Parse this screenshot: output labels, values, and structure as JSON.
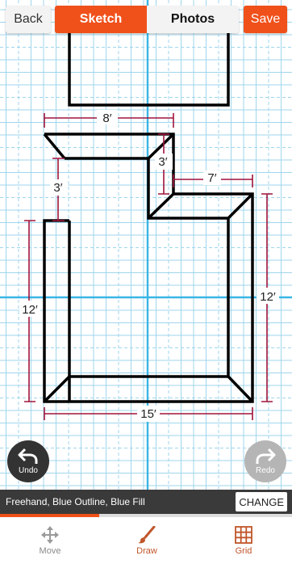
{
  "header": {
    "back_label": "Back",
    "tabs": [
      {
        "label": "Sketch",
        "active": true
      },
      {
        "label": "Photos",
        "active": false
      }
    ],
    "save_label": "Save"
  },
  "sketch": {
    "dimensions": [
      "8′",
      "3′",
      "3′",
      "7′",
      "12′",
      "12′",
      "15′"
    ]
  },
  "controls": {
    "undo_label": "Undo",
    "redo_label": "Redo"
  },
  "status": {
    "mode_text": "Freehand, Blue Outline, Blue Fill",
    "change_label": "CHANGE",
    "progress": 0.34
  },
  "toolbar": {
    "items": [
      {
        "label": "Move",
        "icon": "move-icon",
        "active": false
      },
      {
        "label": "Draw",
        "icon": "brush-icon",
        "active": true
      },
      {
        "label": "Grid",
        "icon": "grid-icon",
        "active": true
      }
    ]
  },
  "colors": {
    "accent": "#f0501a",
    "grid_minor": "#9fd6ec",
    "grid_major": "#39b6e6",
    "dimension": "#a0143c",
    "wall": "#000000"
  }
}
